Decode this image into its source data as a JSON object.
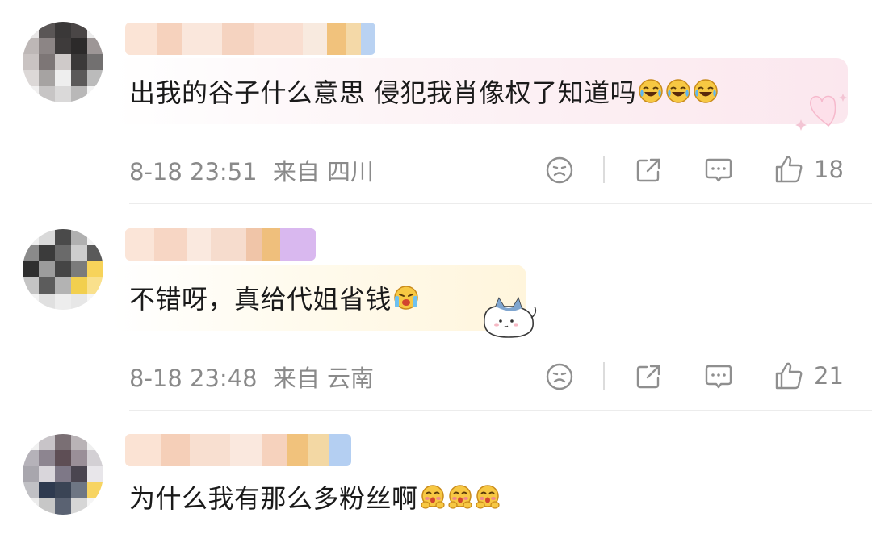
{
  "comments": [
    {
      "text": "出我的谷子什么意思 侵犯我肖像权了知道吗",
      "emojis": [
        "crying-laughing-emoji",
        "crying-laughing-emoji",
        "crying-laughing-emoji"
      ],
      "timestamp": "8-18 23:51",
      "location": "来自 四川",
      "likes": "18"
    },
    {
      "text": "不错呀，真给代姐省钱",
      "emojis": [
        "holding-back-tears-emoji"
      ],
      "timestamp": "8-18 23:48",
      "location": "来自 云南",
      "likes": "21"
    },
    {
      "text": "为什么我有那么多粉丝啊",
      "emojis": [
        "blushing-hands-emoji",
        "blushing-hands-emoji",
        "blushing-hands-emoji"
      ],
      "timestamp": "",
      "location": "",
      "likes": ""
    }
  ],
  "colors": {
    "text": "#1a1a1a",
    "meta": "#8a8a8a",
    "icon": "#8f8f8f",
    "divider": "#ececec"
  }
}
